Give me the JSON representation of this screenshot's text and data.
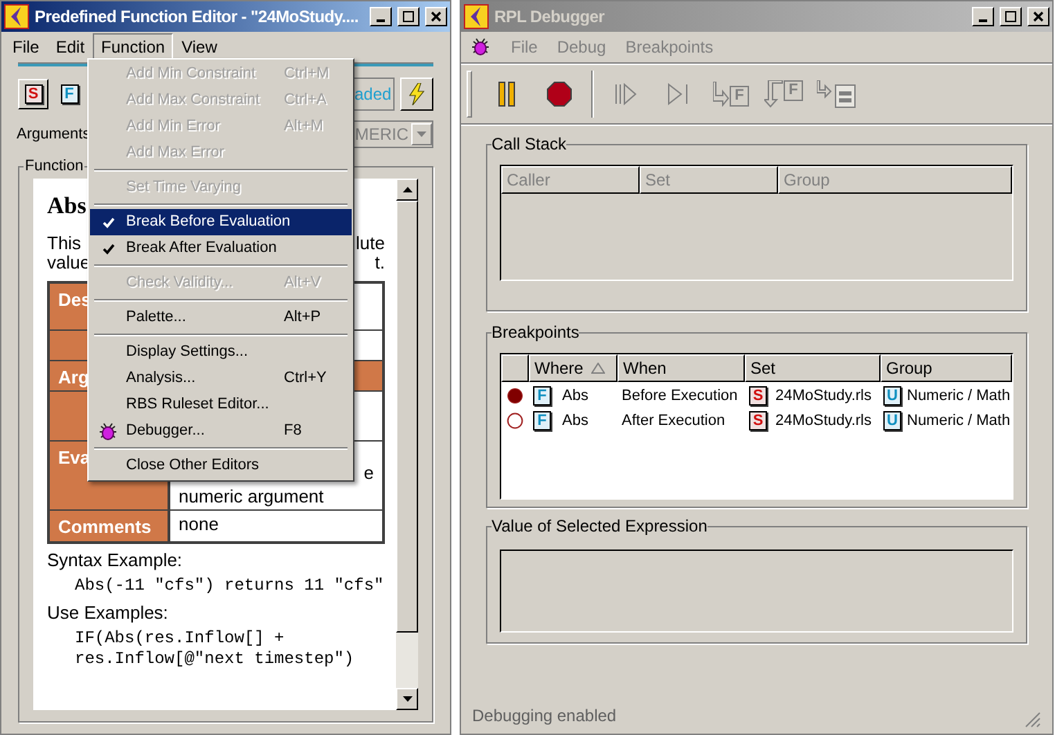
{
  "editor": {
    "title": "Predefined Function Editor - \"24MoStudy....",
    "active": true,
    "menu": [
      {
        "label": "File",
        "selected": false
      },
      {
        "label": "Edit",
        "selected": false
      },
      {
        "label": "Function",
        "selected": true
      },
      {
        "label": "View",
        "selected": false
      }
    ],
    "toolbar": {
      "set_badge": "S",
      "function_badge": "F",
      "status_button": "aded"
    },
    "arguments": {
      "label": "Arguments",
      "dropdown_value": "MERIC"
    },
    "group_title": "Function",
    "doc": {
      "heading": "Abs",
      "intro": [
        {
          "left": "This",
          "right": "lute"
        },
        {
          "left": "value",
          "right": "t."
        }
      ],
      "table": [
        {
          "kind": "field",
          "label": "Des"
        },
        {
          "kind": "field"
        },
        {
          "kind": "section",
          "label": "Arg"
        },
        {
          "kind": "field"
        },
        {
          "kind": "field",
          "label": "Eva",
          "value_tail": "e",
          "value": "numeric argument"
        },
        {
          "kind": "field",
          "label": "Comments",
          "value": "none"
        }
      ],
      "sections": [
        {
          "title": "Syntax Example:",
          "code": "Abs(-11 \"cfs\") returns 11 \"cfs\""
        },
        {
          "title": "Use Examples:",
          "code": "IF(Abs(res.Inflow[] + res.Inflow[@\"next timestep\")"
        }
      ]
    },
    "function_menu": [
      {
        "kind": "item",
        "label": "Add Min Constraint",
        "shortcut": "Ctrl+M",
        "enabled": false,
        "checked": false,
        "selected": false
      },
      {
        "kind": "item",
        "label": "Add Max Constraint",
        "shortcut": "Ctrl+A",
        "enabled": false,
        "checked": false,
        "selected": false
      },
      {
        "kind": "item",
        "label": "Add Min Error",
        "shortcut": "Alt+M",
        "enabled": false,
        "checked": false,
        "selected": false
      },
      {
        "kind": "item",
        "label": "Add Max Error",
        "enabled": false,
        "checked": false,
        "selected": false
      },
      {
        "kind": "separator"
      },
      {
        "kind": "item",
        "label": "Set Time Varying",
        "enabled": false,
        "checked": false,
        "selected": false
      },
      {
        "kind": "separator"
      },
      {
        "kind": "item",
        "label": "Break Before Evaluation",
        "enabled": true,
        "checked": true,
        "selected": true
      },
      {
        "kind": "item",
        "label": "Break After Evaluation",
        "enabled": true,
        "checked": true,
        "selected": false
      },
      {
        "kind": "separator"
      },
      {
        "kind": "item",
        "label": "Check Validity...",
        "shortcut": "Alt+V",
        "enabled": false,
        "checked": false,
        "selected": false
      },
      {
        "kind": "separator"
      },
      {
        "kind": "item",
        "label": "Palette...",
        "shortcut": "Alt+P",
        "enabled": true,
        "checked": false,
        "selected": false
      },
      {
        "kind": "separator"
      },
      {
        "kind": "item",
        "label": "Display Settings...",
        "enabled": true,
        "checked": false,
        "selected": false
      },
      {
        "kind": "item",
        "label": "Analysis...",
        "shortcut": "Ctrl+Y",
        "enabled": true,
        "checked": false,
        "selected": false
      },
      {
        "kind": "item",
        "label": "RBS Ruleset Editor...",
        "enabled": true,
        "checked": false,
        "selected": false
      },
      {
        "kind": "bug_item",
        "label": "Debugger...",
        "shortcut": "F8",
        "enabled": true,
        "checked": false,
        "selected": false
      },
      {
        "kind": "separator"
      },
      {
        "kind": "item",
        "label": "Close Other Editors",
        "enabled": true,
        "checked": false,
        "selected": false
      }
    ]
  },
  "debugger": {
    "title": "RPL Debugger",
    "active": false,
    "menu": [
      {
        "label": "File",
        "enabled": false
      },
      {
        "label": "Debug",
        "enabled": false
      },
      {
        "label": "Breakpoints",
        "enabled": false
      }
    ],
    "toolbar": [
      {
        "kind": "pause",
        "enabled": true
      },
      {
        "kind": "stop",
        "enabled": true
      },
      {
        "kind": "separator"
      },
      {
        "kind": "step",
        "enabled": false
      },
      {
        "kind": "step_end",
        "enabled": false
      },
      {
        "kind": "step_into",
        "enabled": false,
        "badge": "F"
      },
      {
        "kind": "step_out",
        "enabled": false,
        "badge": "F"
      },
      {
        "kind": "step_over",
        "enabled": false
      }
    ],
    "call_stack": {
      "title": "Call Stack",
      "columns": [
        {
          "label": "Caller"
        },
        {
          "label": "Set"
        },
        {
          "label": "Group"
        }
      ]
    },
    "breakpoints": {
      "title": "Breakpoints",
      "columns": [
        {
          "label": "Where",
          "sorted": true
        },
        {
          "label": "When",
          "sorted": false
        },
        {
          "label": "Set",
          "sorted": false
        },
        {
          "label": "Group",
          "sorted": false
        }
      ],
      "rows": [
        {
          "active": true,
          "where_badge": "F",
          "where": "Abs",
          "when": "Before Execution",
          "set_badge": "S",
          "set": "24MoStudy.rls",
          "group_badge": "U",
          "group": "Numeric / Math"
        },
        {
          "active": false,
          "where_badge": "F",
          "where": "Abs",
          "when": "After Execution",
          "set_badge": "S",
          "set": "24MoStudy.rls",
          "group_badge": "U",
          "group": "Numeric / Math"
        }
      ]
    },
    "value_panel": {
      "title": "Value of Selected Expression"
    },
    "status_bar": "Debugging enabled"
  }
}
